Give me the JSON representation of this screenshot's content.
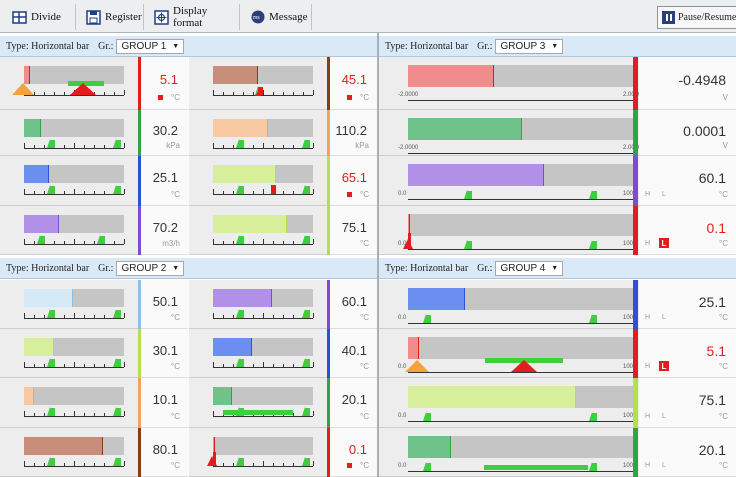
{
  "toolbar": {
    "divide": "Divide",
    "register": "Register",
    "display_format": "Display format",
    "message": "Message",
    "pause_resume": "Pause/Resume"
  },
  "groups": [
    {
      "type_label": "Type: Horizontal bar",
      "gr_label": "Gr.:",
      "group_name": "GROUP 1"
    },
    {
      "type_label": "Type: Horizontal bar",
      "gr_label": "Gr.:",
      "group_name": "GROUP 3"
    },
    {
      "type_label": "Type: Horizontal bar",
      "gr_label": "Gr.:",
      "group_name": "GROUP 2"
    },
    {
      "type_label": "Type: Horizontal bar",
      "gr_label": "Gr.:",
      "group_name": "GROUP 4"
    }
  ],
  "small_tiles": [
    {
      "value": "5.1",
      "unit": "°C",
      "fill_pct": 0.06,
      "fill": "#f08c8c",
      "strip": "#e21d1d",
      "alarm": true,
      "val_color": "#e21d1d",
      "markers": [],
      "special": "orange-red"
    },
    {
      "value": "45.1",
      "unit": "°C",
      "fill_pct": 0.45,
      "fill": "#c98e79",
      "strip": "#8b3a1a",
      "alarm": true,
      "val_color": "#e21d1d",
      "markers": [
        0.45
      ],
      "special": "red-marker"
    },
    {
      "value": "30.2",
      "unit": "kPa",
      "fill_pct": 0.17,
      "fill": "#6fc28a",
      "strip": "#2ca54a",
      "alarm": false,
      "val_color": "#333",
      "markers": [
        0.26,
        0.92
      ],
      "special": ""
    },
    {
      "value": "110.2",
      "unit": "kPa",
      "fill_pct": 0.55,
      "fill": "#f7c9a2",
      "strip": "#f5a35c",
      "alarm": false,
      "val_color": "#333",
      "markers": [
        0.26,
        0.92
      ],
      "special": ""
    },
    {
      "value": "25.1",
      "unit": "°C",
      "fill_pct": 0.25,
      "fill": "#6b8ff0",
      "strip": "#2a52d6",
      "alarm": false,
      "val_color": "#333",
      "markers": [
        0.26,
        0.92
      ],
      "special": ""
    },
    {
      "value": "65.1",
      "unit": "°C",
      "fill_pct": 0.63,
      "fill": "#d7ee9b",
      "strip": "#b6e04b",
      "alarm": true,
      "val_color": "#e21d1d",
      "markers": [
        0.26,
        0.92
      ],
      "special": "red-mk"
    },
    {
      "value": "70.2",
      "unit": "m3/h",
      "fill_pct": 0.35,
      "fill": "#b191e8",
      "strip": "#7e4bd6",
      "alarm": false,
      "val_color": "#333",
      "markers": [
        0.16,
        0.76
      ],
      "special": ""
    },
    {
      "value": "75.1",
      "unit": "°C",
      "fill_pct": 0.74,
      "fill": "#d7ee9b",
      "strip": "#b6e04b",
      "alarm": false,
      "val_color": "#333",
      "markers": [
        0.26,
        0.92
      ],
      "special": ""
    },
    {
      "value": "50.1",
      "unit": "°C",
      "fill_pct": 0.49,
      "fill": "#d4e8f5",
      "strip": "#8dc1e3",
      "alarm": false,
      "val_color": "#333",
      "markers": [
        0.26,
        0.92
      ],
      "special": ""
    },
    {
      "value": "60.1",
      "unit": "°C",
      "fill_pct": 0.59,
      "fill": "#b191e8",
      "strip": "#7e4bd6",
      "alarm": false,
      "val_color": "#333",
      "markers": [
        0.26,
        0.92
      ],
      "special": ""
    },
    {
      "value": "30.1",
      "unit": "°C",
      "fill_pct": 0.3,
      "fill": "#d7ee9b",
      "strip": "#b6e04b",
      "alarm": false,
      "val_color": "#333",
      "markers": [
        0.26,
        0.92
      ],
      "special": ""
    },
    {
      "value": "40.1",
      "unit": "°C",
      "fill_pct": 0.39,
      "fill": "#6b8ff0",
      "strip": "#2a52d6",
      "alarm": false,
      "val_color": "#333",
      "markers": [
        0.26,
        0.92
      ],
      "special": ""
    },
    {
      "value": "10.1",
      "unit": "°C",
      "fill_pct": 0.1,
      "fill": "#f7c9a2",
      "strip": "#f5a35c",
      "alarm": false,
      "val_color": "#333",
      "markers": [
        0.26,
        0.92
      ],
      "special": ""
    },
    {
      "value": "20.1",
      "unit": "°C",
      "fill_pct": 0.19,
      "fill": "#6fc28a",
      "strip": "#2ca54a",
      "alarm": false,
      "val_color": "#333",
      "markers": [
        0.26,
        0.92
      ],
      "special": "gbar"
    },
    {
      "value": "80.1",
      "unit": "°C",
      "fill_pct": 0.79,
      "fill": "#c98e79",
      "strip": "#8b3a1a",
      "alarm": false,
      "val_color": "#333",
      "markers": [
        0.26,
        0.92
      ],
      "special": ""
    },
    {
      "value": "0.1",
      "unit": "°C",
      "fill_pct": 0.0,
      "fill": "#f08c8c",
      "strip": "#e21d1d",
      "alarm": true,
      "val_color": "#e21d1d",
      "markers": [
        0.26,
        0.92
      ],
      "special": "red-left"
    }
  ],
  "wide_tiles": [
    {
      "value": "-0.4948",
      "unit": "V",
      "axis_min": "-2.0000",
      "axis_max": "2.0000",
      "fill_pct": 0.38,
      "fill": "#f08c8c",
      "strip": "#e21d1d",
      "val_color": "#333",
      "hl": false,
      "alarm": false,
      "markers": [],
      "special": ""
    },
    {
      "value": "0.0001",
      "unit": "V",
      "axis_min": "-2.0000",
      "axis_max": "2.0000",
      "fill_pct": 0.5,
      "fill": "#6fc28a",
      "strip": "#2ca54a",
      "val_color": "#333",
      "hl": false,
      "alarm": false,
      "markers": [],
      "special": ""
    },
    {
      "value": "60.1",
      "unit": "°C",
      "axis_min": "0.0",
      "axis_max": "100.0",
      "fill_pct": 0.6,
      "fill": "#b191e8",
      "strip": "#7e4bd6",
      "val_color": "#333",
      "hl": true,
      "alarm": false,
      "markers": [
        0.26,
        0.81
      ],
      "special": ""
    },
    {
      "value": "0.1",
      "unit": "°C",
      "axis_min": "0.0",
      "axis_max": "100.0",
      "fill_pct": 0.0,
      "fill": "#f08c8c",
      "strip": "#e21d1d",
      "val_color": "#e21d1d",
      "hl": true,
      "alarm": true,
      "markers": [
        0.26,
        0.81
      ],
      "special": "red-left"
    },
    {
      "value": "25.1",
      "unit": "°C",
      "axis_min": "0.0",
      "axis_max": "100.0",
      "fill_pct": 0.25,
      "fill": "#6b8ff0",
      "strip": "#2a52d6",
      "val_color": "#333",
      "hl": true,
      "alarm": false,
      "markers": [
        0.08,
        0.81
      ],
      "special": ""
    },
    {
      "value": "5.1",
      "unit": "°C",
      "axis_min": "0.0",
      "axis_max": "100.0",
      "fill_pct": 0.05,
      "fill": "#f08c8c",
      "strip": "#e21d1d",
      "val_color": "#e21d1d",
      "hl": true,
      "alarm": true,
      "markers": [],
      "special": "orange-red"
    },
    {
      "value": "75.1",
      "unit": "°C",
      "axis_min": "0.0",
      "axis_max": "100.0",
      "fill_pct": 0.74,
      "fill": "#d7ee9b",
      "strip": "#b6e04b",
      "val_color": "#333",
      "hl": true,
      "alarm": false,
      "markers": [
        0.08,
        0.81
      ],
      "special": ""
    },
    {
      "value": "20.1",
      "unit": "°C",
      "axis_min": "0.0",
      "axis_max": "100.0",
      "fill_pct": 0.19,
      "fill": "#6fc28a",
      "strip": "#2ca54a",
      "val_color": "#333",
      "hl": true,
      "alarm": false,
      "markers": [
        0.08,
        0.81
      ],
      "special": "gbar"
    }
  ],
  "hl_label": "H L",
  "alarm_badge": "L"
}
